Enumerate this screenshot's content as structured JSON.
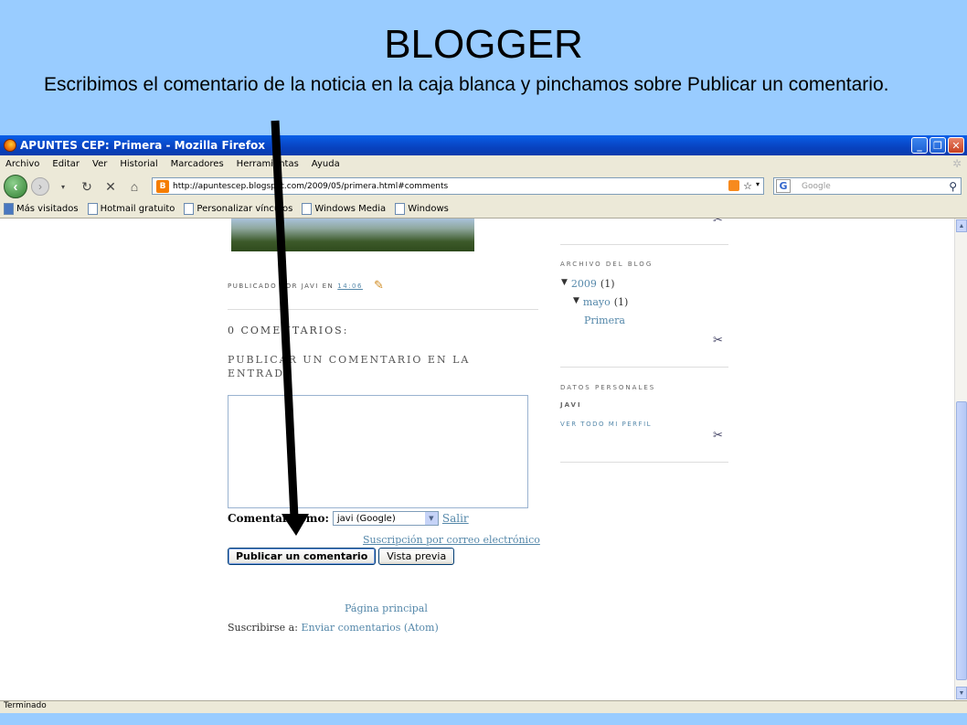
{
  "slide": {
    "title": "BLOGGER",
    "description": "Escribimos el comentario de la noticia en la caja blanca y pinchamos sobre Publicar un comentario."
  },
  "window": {
    "title": "APUNTES CEP: Primera - Mozilla Firefox",
    "buttons": [
      "minimize-icon",
      "restore-icon",
      "close-icon"
    ]
  },
  "menu": [
    "Archivo",
    "Editar",
    "Ver",
    "Historial",
    "Marcadores",
    "Herramientas",
    "Ayuda"
  ],
  "nav": {
    "url": "http://apuntescep.blogspot.com/2009/05/primera.html#comments",
    "search_placeholder": "Google"
  },
  "bookmarks": [
    "Más visitados",
    "Hotmail gratuito",
    "Personalizar vínculos",
    "Windows Media",
    "Windows"
  ],
  "post": {
    "published_prefix": "PUBLICADO POR JAVI EN",
    "time": "14:06",
    "comments_count": "0 COMENTARIOS:",
    "post_comment_heading": "PUBLICAR UN COMENTARIO EN LA ENTRADA"
  },
  "comment_form": {
    "comment_as_label": "Comentar como:",
    "identity": "javi (Google)",
    "logout": "Salir",
    "email_subscribe": "Suscripción por correo electrónico",
    "publish_button": "Publicar un comentario",
    "preview_button": "Vista previa"
  },
  "footer": {
    "home": "Página principal",
    "subscribe_prefix": "Suscribirse a:",
    "subscribe_link": "Enviar comentarios (Atom)"
  },
  "sidebar": {
    "archive_heading": "ARCHIVO DEL BLOG",
    "archive": {
      "year": "2009",
      "year_count": "(1)",
      "month": "mayo",
      "month_count": "(1)",
      "post": "Primera"
    },
    "profile_heading": "DATOS PERSONALES",
    "profile_name": "JAVI",
    "profile_link": "VER TODO MI PERFIL"
  },
  "status": "Terminado",
  "colors": {
    "slide_background": "#99ccff",
    "link": "#5588aa",
    "titlebar": "#0842c0",
    "arrow": "#000000"
  }
}
